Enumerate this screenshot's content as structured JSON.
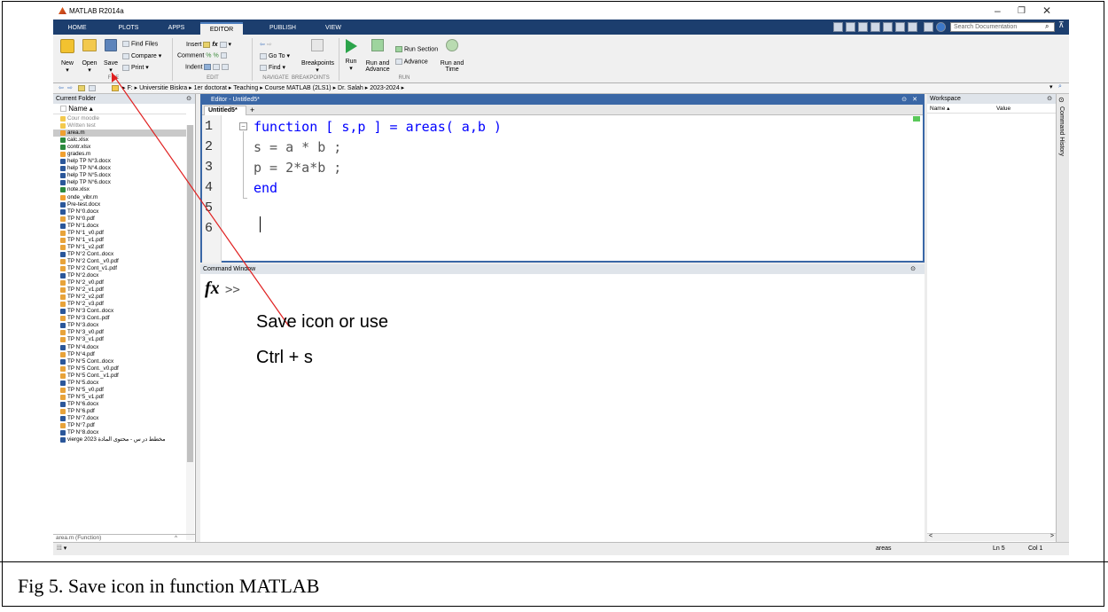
{
  "app": {
    "title": "MATLAB R2014a"
  },
  "tabs": [
    {
      "label": "HOME"
    },
    {
      "label": "PLOTS"
    },
    {
      "label": "APPS"
    },
    {
      "label": "EDITOR",
      "active": true
    },
    {
      "label": "PUBLISH"
    },
    {
      "label": "VIEW"
    }
  ],
  "search": {
    "placeholder": "Search Documentation"
  },
  "toolstrip": {
    "file": {
      "new": "New",
      "open": "Open",
      "save": "Save",
      "find_files": "Find Files",
      "compare": "Compare",
      "print": "Print",
      "section": "FILE"
    },
    "edit": {
      "insert": "Insert",
      "comment": "Comment",
      "indent": "Indent",
      "section": "EDIT"
    },
    "navigate": {
      "go_to": "Go To",
      "find": "Find",
      "section": "NAVIGATE"
    },
    "breakpoints": {
      "label": "Breakpoints",
      "section": "BREAKPOINTS"
    },
    "run": {
      "run": "Run",
      "run_advance_1": "Run and",
      "run_advance_2": "Advance",
      "run_section": "Run Section",
      "advance": "Advance",
      "run_time_1": "Run and",
      "run_time_2": "Time",
      "section": "RUN"
    }
  },
  "address": {
    "path": [
      "F:",
      "Universitie Biskra",
      "1er doctorat",
      "Teaching",
      "Course MATLAB (2LS1)",
      "Dr. Salah",
      "2023-2024"
    ]
  },
  "current_folder": {
    "title": "Current Folder",
    "column": "Name",
    "items": [
      {
        "name": "Cour moodle",
        "type": "folder"
      },
      {
        "name": "Written test",
        "type": "folder"
      },
      {
        "name": "area.m",
        "type": "m",
        "selected": true
      },
      {
        "name": "calc.xlsx",
        "type": "xlsx"
      },
      {
        "name": "contr.xlsx",
        "type": "xlsx"
      },
      {
        "name": "grades.m",
        "type": "m"
      },
      {
        "name": "help TP N°3.docx",
        "type": "docx"
      },
      {
        "name": "help TP N°4.docx",
        "type": "docx"
      },
      {
        "name": "help TP N°5.docx",
        "type": "docx"
      },
      {
        "name": "help TP N°6.docx",
        "type": "docx"
      },
      {
        "name": "note.xlsx",
        "type": "xlsx"
      },
      {
        "name": "onde_vibr.m",
        "type": "m"
      },
      {
        "name": "Pre-test.docx",
        "type": "docx"
      },
      {
        "name": "TP N°0.docx",
        "type": "docx"
      },
      {
        "name": "TP N°0.pdf",
        "type": "pdf"
      },
      {
        "name": "TP N°1.docx",
        "type": "docx"
      },
      {
        "name": "TP N°1_v0.pdf",
        "type": "pdf"
      },
      {
        "name": "TP N°1_v1.pdf",
        "type": "pdf"
      },
      {
        "name": "TP N°1_v2.pdf",
        "type": "pdf"
      },
      {
        "name": "TP N°2 Cont..docx",
        "type": "docx"
      },
      {
        "name": "TP N°2 Cont._v0.pdf",
        "type": "pdf"
      },
      {
        "name": "TP N°2 Cont_v1.pdf",
        "type": "pdf"
      },
      {
        "name": "TP N°2.docx",
        "type": "docx"
      },
      {
        "name": "TP N°2_v0.pdf",
        "type": "pdf"
      },
      {
        "name": "TP N°2_v1.pdf",
        "type": "pdf"
      },
      {
        "name": "TP N°2_v2.pdf",
        "type": "pdf"
      },
      {
        "name": "TP N°2_v3.pdf",
        "type": "pdf"
      },
      {
        "name": "TP N°3 Cont..docx",
        "type": "docx"
      },
      {
        "name": "TP N°3 Cont..pdf",
        "type": "pdf"
      },
      {
        "name": "TP N°3.docx",
        "type": "docx"
      },
      {
        "name": "TP N°3_v0.pdf",
        "type": "pdf"
      },
      {
        "name": "TP N°3_v1.pdf",
        "type": "pdf"
      },
      {
        "name": "TP N°4.docx",
        "type": "docx"
      },
      {
        "name": "TP N°4.pdf",
        "type": "pdf"
      },
      {
        "name": "TP N°5 Cont..docx",
        "type": "docx"
      },
      {
        "name": "TP N°5 Cont._v0.pdf",
        "type": "pdf"
      },
      {
        "name": "TP N°5 Cont._v1.pdf",
        "type": "pdf"
      },
      {
        "name": "TP N°5.docx",
        "type": "docx"
      },
      {
        "name": "TP N°5_v0.pdf",
        "type": "pdf"
      },
      {
        "name": "TP N°5_v1.pdf",
        "type": "pdf"
      },
      {
        "name": "TP N°6.docx",
        "type": "docx"
      },
      {
        "name": "TP N°6.pdf",
        "type": "pdf"
      },
      {
        "name": "TP N°7.docx",
        "type": "docx"
      },
      {
        "name": "TP N°7.pdf",
        "type": "pdf"
      },
      {
        "name": "TP N°8.docx",
        "type": "docx"
      },
      {
        "name": "vierge 2023 مخطط در س - محتوى المادة",
        "type": "docx"
      }
    ],
    "details": "area.m (Function)"
  },
  "editor": {
    "title": "Editor - Untitled5*",
    "tab": "Untitled5*",
    "lines": [
      {
        "n": "1",
        "kw": "function",
        "rest": " [ s,p ] = areas( a,b )",
        "kwclass": "kw",
        "restclass": "kw"
      },
      {
        "n": "2",
        "kw": "",
        "rest": "s = a * b ;",
        "kwclass": "",
        "restclass": ""
      },
      {
        "n": "3",
        "kw": "",
        "rest": "p = 2*a*b ;",
        "kwclass": "",
        "restclass": ""
      },
      {
        "n": "4",
        "kw": "end",
        "rest": "",
        "kwclass": "kw",
        "restclass": ""
      },
      {
        "n": "5",
        "kw": "",
        "rest": "",
        "kwclass": "",
        "restclass": ""
      },
      {
        "n": "6",
        "kw": "",
        "rest": "",
        "kwclass": "",
        "restclass": ""
      }
    ]
  },
  "command_window": {
    "title": "Command Window",
    "fx": "fx",
    "prompt": ">>"
  },
  "workspace": {
    "title": "Workspace",
    "col_name": "Name",
    "col_value": "Value"
  },
  "history": {
    "title": "Command History"
  },
  "status": {
    "func": "areas",
    "ln": "Ln  5",
    "col": "Col  1"
  },
  "annotation": {
    "line1": "Save icon or use",
    "line2": "Ctrl + s"
  },
  "caption": "Fig 5. Save icon in function MATLAB",
  "colors": {
    "tabbar": "#1c3e6e",
    "editor_border": "#3a67a6",
    "keyword": "#0000ff",
    "arrow": "#e02020"
  }
}
